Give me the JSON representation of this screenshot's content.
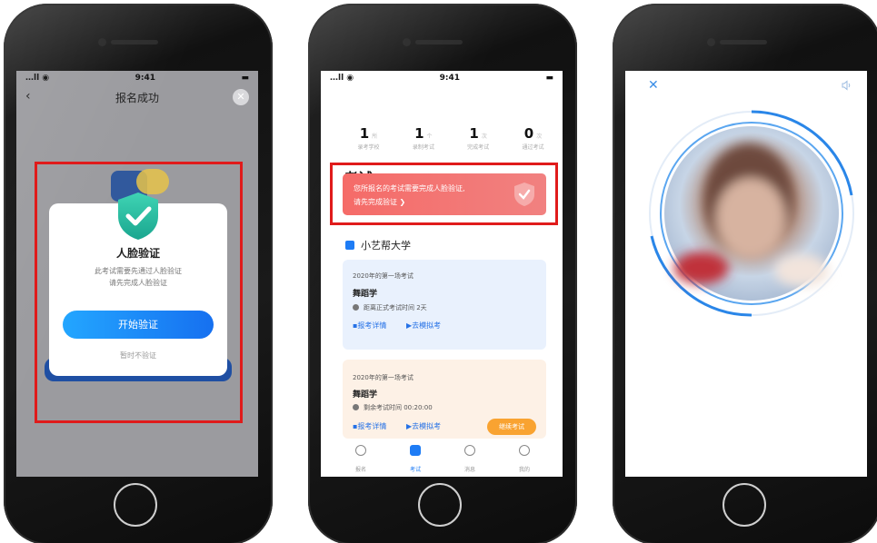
{
  "phone1": {
    "status": {
      "time": "9:41",
      "signal": "…ll ◉"
    },
    "nav": {
      "title": "报名成功",
      "back_icon": "chevron-left-icon",
      "close_icon": "close-icon"
    },
    "modal": {
      "title": "人脸验证",
      "desc_line1": "此考试需要先通过人脸验证",
      "desc_line2": "请先完成人脸验证",
      "primary_button": "开始验证",
      "secondary_link": "暂时不验证"
    }
  },
  "phone2": {
    "status": {
      "time": "9:41",
      "signal": "…ll ◉"
    },
    "page_title": "考试",
    "stats": [
      {
        "value": "1",
        "unit": "所",
        "label": "录考学校"
      },
      {
        "value": "1",
        "unit": "个",
        "label": "录制考试"
      },
      {
        "value": "1",
        "unit": "次",
        "label": "完成考试"
      },
      {
        "value": "0",
        "unit": "次",
        "label": "通过考试"
      }
    ],
    "alert": {
      "line1": "您所报名的考试需要完成人脸验证,",
      "line2": "请先完成验证 ❯"
    },
    "school_name": "小艺帮大学",
    "cards": [
      {
        "subtitle": "2020年的第一场考试",
        "name": "舞蹈学",
        "time": "距离正式考试时间 2天",
        "link1": "报考详情",
        "link2": "去模拟考"
      },
      {
        "subtitle": "2020年的第一场考试",
        "name": "舞蹈学",
        "time": "剩余考试时间 00:20:00",
        "link1": "报考详情",
        "link2": "去模拟考",
        "button": "继续考试"
      }
    ],
    "tabs": [
      {
        "label": "报名",
        "icon": "home-icon"
      },
      {
        "label": "考试",
        "icon": "exam-icon"
      },
      {
        "label": "消息",
        "icon": "message-icon"
      },
      {
        "label": "我的",
        "icon": "profile-icon"
      }
    ]
  },
  "phone3": {
    "close_icon": "close-icon",
    "sound_icon": "speaker-icon"
  },
  "colors": {
    "accent": "#1e7cf5",
    "alert": "#f56b68",
    "highlight": "#e01b1b",
    "shield": "#2ec4a6",
    "button": "#f9a331"
  }
}
